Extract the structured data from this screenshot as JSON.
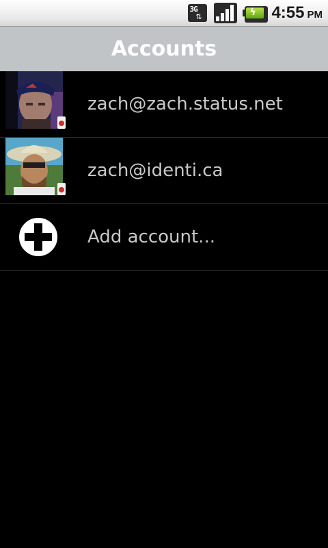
{
  "status_bar": {
    "network_type": "3G",
    "time": "4:55",
    "ampm": "PM",
    "icons": [
      "3g-data-icon",
      "signal-strength-icon",
      "battery-charging-icon"
    ]
  },
  "title_bar": {
    "title": "Accounts"
  },
  "accounts": [
    {
      "label": "zach@zach.status.net",
      "avatar": "avatar-photo"
    },
    {
      "label": "zach@identi.ca",
      "avatar": "avatar-photo"
    }
  ],
  "add_account": {
    "label": "Add account...",
    "icon": "add-icon"
  },
  "colors": {
    "title_bar_bg": "#c0c4c7",
    "background": "#000000",
    "list_text": "#c9c9c9",
    "divider": "#2e2e2e"
  }
}
